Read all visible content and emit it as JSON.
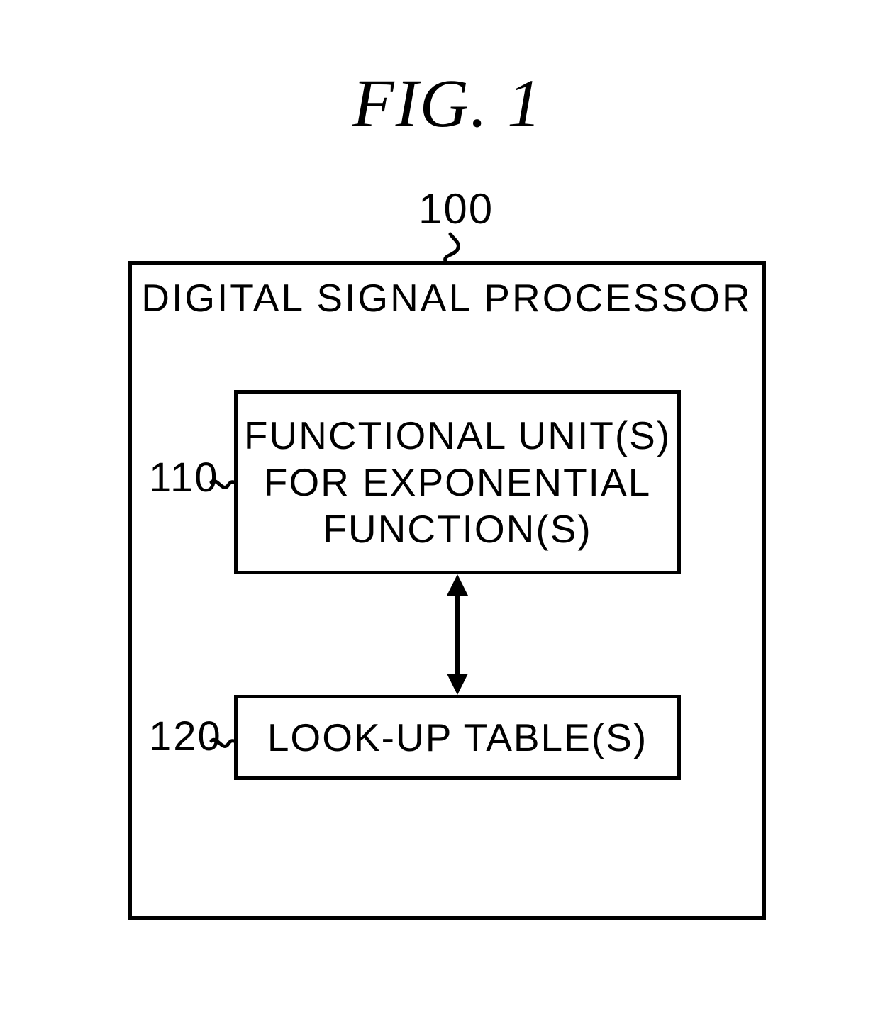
{
  "figure": {
    "title": "FIG.  1"
  },
  "refs": {
    "r100": "100",
    "r110": "110",
    "r120": "120"
  },
  "blocks": {
    "dsp": "DIGITAL SIGNAL PROCESSOR",
    "func_line1": "FUNCTIONAL UNIT(S)",
    "func_line2": "FOR EXPONENTIAL",
    "func_line3": "FUNCTION(S)",
    "lut": "LOOK-UP TABLE(S)"
  }
}
